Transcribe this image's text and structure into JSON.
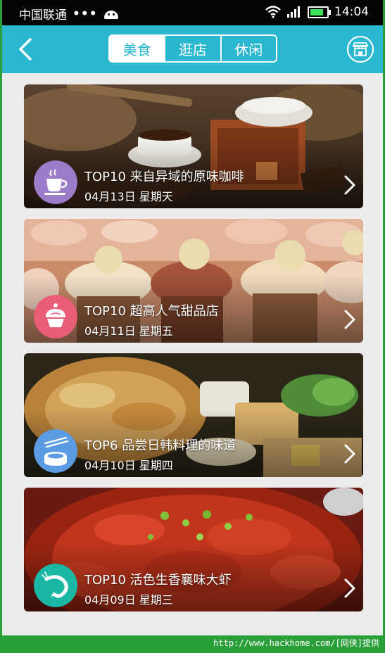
{
  "statusbar": {
    "carrier": "中国联通",
    "dots": "•••",
    "time": "14:04"
  },
  "header": {
    "tabs": [
      {
        "label": "美食"
      },
      {
        "label": "逛店"
      },
      {
        "label": "休闲"
      }
    ]
  },
  "cards": [
    {
      "title": "TOP10 来自异域的原味咖啡",
      "date": "04月13日 星期天",
      "icon": "coffee-cup-icon",
      "badge_color": "#9b7cc9"
    },
    {
      "title": "TOP10 超高人气甜品店",
      "date": "04月11日 星期五",
      "icon": "cupcake-icon",
      "badge_color": "#e95d77"
    },
    {
      "title": "TOP6 品尝日韩料理的味道",
      "date": "04月10日 星期四",
      "icon": "sushi-icon",
      "badge_color": "#5a9be3"
    },
    {
      "title": "TOP10 活色生香襄味大虾",
      "date": "04月09日 星期三",
      "icon": "shrimp-icon",
      "badge_color": "#19b7a4"
    }
  ],
  "footer": {
    "watermark": "http://www.hackhome.com/[网侠]提供"
  },
  "colors": {
    "accent": "#29b8cf",
    "background": "#ececec"
  }
}
